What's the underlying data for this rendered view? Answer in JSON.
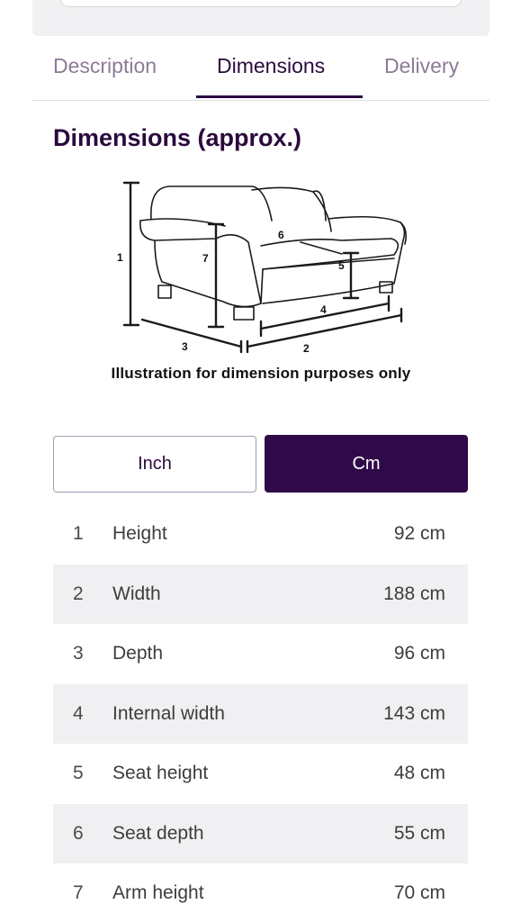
{
  "tabs": [
    {
      "label": "Description"
    },
    {
      "label": "Dimensions"
    },
    {
      "label": "Delivery"
    }
  ],
  "section_title": "Dimensions (approx.)",
  "illustration": {
    "caption": "Illustration for dimension purposes only",
    "markers": [
      "1",
      "2",
      "3",
      "4",
      "5",
      "6",
      "7"
    ]
  },
  "units": {
    "inch_label": "Inch",
    "cm_label": "Cm",
    "selected": "Cm"
  },
  "dimensions": [
    {
      "num": "1",
      "label": "Height",
      "value": "92 cm"
    },
    {
      "num": "2",
      "label": "Width",
      "value": "188 cm"
    },
    {
      "num": "3",
      "label": "Depth",
      "value": "96 cm"
    },
    {
      "num": "4",
      "label": "Internal width",
      "value": "143 cm"
    },
    {
      "num": "5",
      "label": "Seat height",
      "value": "48 cm"
    },
    {
      "num": "6",
      "label": "Seat depth",
      "value": "55 cm"
    },
    {
      "num": "7",
      "label": "Arm height",
      "value": "70 cm"
    }
  ],
  "colors": {
    "accent": "#2f0a48",
    "tab_inactive": "#8d7a97",
    "row_shade": "#f0f0f2"
  }
}
